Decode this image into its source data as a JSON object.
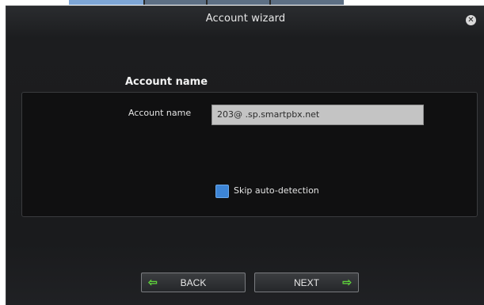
{
  "window": {
    "title": "Account wizard",
    "close_icon": "close-icon"
  },
  "section": {
    "title": "Account name"
  },
  "form": {
    "account_name_label": "Account name",
    "account_name_value": "203@        .sp.smartpbx.net",
    "skip_label": "Skip auto-detection",
    "skip_checked": false
  },
  "buttons": {
    "back_label": "BACK",
    "next_label": "NEXT",
    "back_icon": "arrow-left-icon",
    "next_icon": "arrow-right-icon"
  },
  "colors": {
    "arrow": "#5fd43b",
    "checkbox": "#3d85d6"
  }
}
